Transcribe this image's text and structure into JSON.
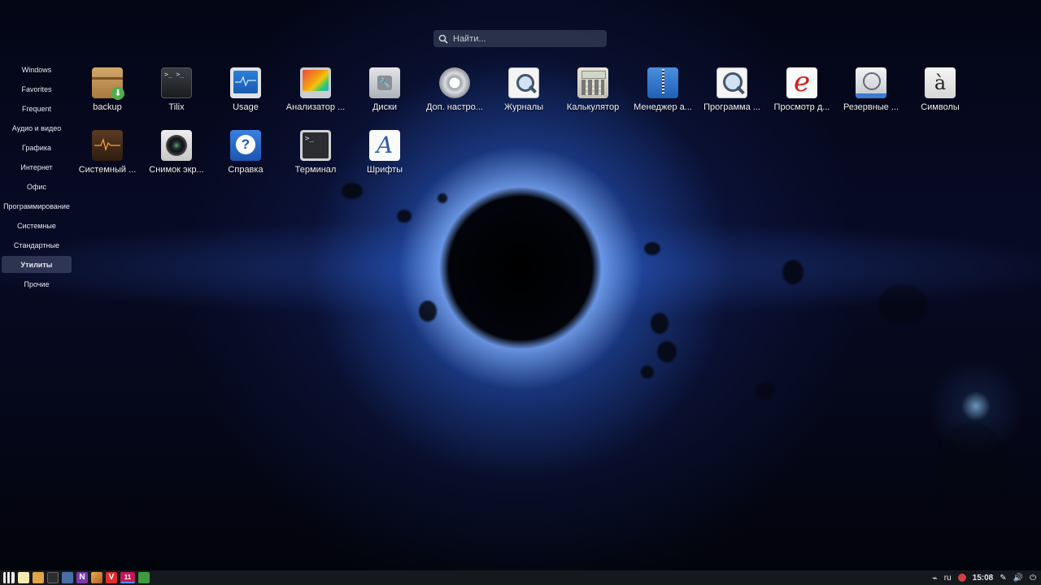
{
  "search": {
    "placeholder": "Найти..."
  },
  "categories": [
    {
      "label": "Windows"
    },
    {
      "label": "Favorites"
    },
    {
      "label": "Frequent"
    },
    {
      "label": "Аудио и видео"
    },
    {
      "label": "Графика"
    },
    {
      "label": "Интернет"
    },
    {
      "label": "Офис"
    },
    {
      "label": "Программирование"
    },
    {
      "label": "Системные"
    },
    {
      "label": "Стандартные"
    },
    {
      "label": "Утилиты",
      "active": true
    },
    {
      "label": "Прочие"
    }
  ],
  "apps": [
    {
      "label": "backup",
      "icon": "package-icon"
    },
    {
      "label": "Tilix",
      "icon": "terminal-icon"
    },
    {
      "label": "Usage",
      "icon": "usage-monitor-icon"
    },
    {
      "label": "Анализатор ...",
      "icon": "disk-analyzer-icon"
    },
    {
      "label": "Диски",
      "icon": "disks-icon"
    },
    {
      "label": "Доп. настро...",
      "icon": "tweaks-icon"
    },
    {
      "label": "Журналы",
      "icon": "logs-icon"
    },
    {
      "label": "Калькулятор",
      "icon": "calculator-icon"
    },
    {
      "label": "Менеджер а...",
      "icon": "archive-manager-icon"
    },
    {
      "label": "Программа ...",
      "icon": "search-doc-icon"
    },
    {
      "label": "Просмотр д...",
      "icon": "document-viewer-icon"
    },
    {
      "label": "Резервные ...",
      "icon": "backup-clock-icon"
    },
    {
      "label": "Символы",
      "icon": "characters-icon"
    },
    {
      "label": "Системный ...",
      "icon": "system-monitor-icon"
    },
    {
      "label": "Снимок экр...",
      "icon": "screenshot-icon"
    },
    {
      "label": "Справка",
      "icon": "help-icon"
    },
    {
      "label": "Терминал",
      "icon": "terminal-icon"
    },
    {
      "label": "Шрифты",
      "icon": "fonts-icon"
    }
  ],
  "taskbar": {
    "pinned": [
      "menu-icon",
      "text-editor-icon",
      "files-icon",
      "terminal-icon",
      "screenshot-icon",
      "onenote-icon",
      "image-viewer-icon",
      "vivaldi-icon",
      "app-11-icon",
      "green-app-icon"
    ],
    "app_11_label": "11",
    "onenote_letter": "N",
    "vivaldi_letter": "V",
    "tray_lang": "ru",
    "tray_time": "15:08"
  }
}
